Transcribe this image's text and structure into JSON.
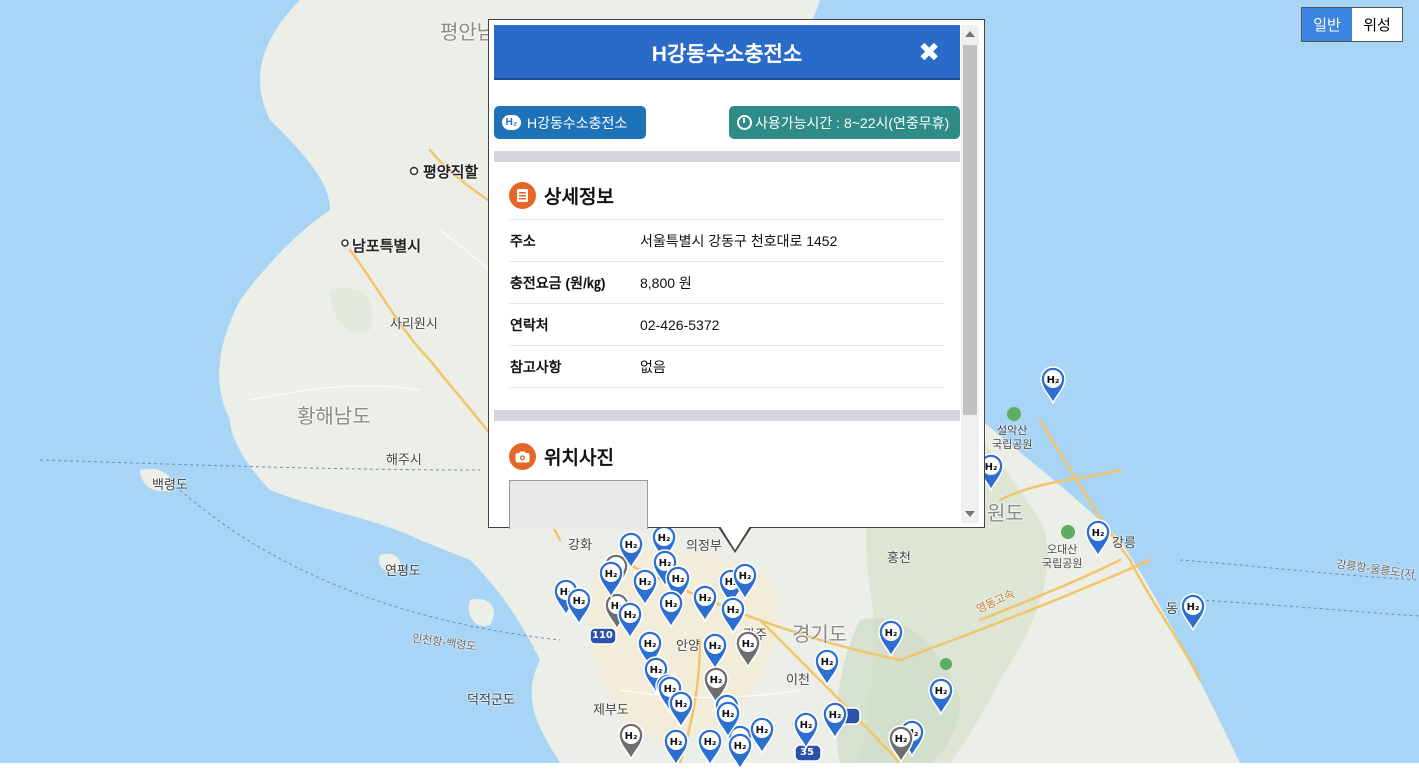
{
  "map_labels": [
    {
      "text": "평안남",
      "cls": "mt-lg"
    },
    {
      "text": "평양직할",
      "cls": "mt-md"
    },
    {
      "text": "남포특별시",
      "cls": "mt-md"
    },
    {
      "text": "사리원시",
      "cls": "mt-sm"
    },
    {
      "text": "황해남도",
      "cls": "mt-lg"
    },
    {
      "text": "해주시",
      "cls": "mt-sm"
    },
    {
      "text": "백령도",
      "cls": "mt-sm"
    },
    {
      "text": "연평도",
      "cls": "mt-sm"
    },
    {
      "text": "인천항-백령도",
      "cls": "mt-road"
    },
    {
      "text": "덕적군도",
      "cls": "mt-sm"
    },
    {
      "text": "제부도",
      "cls": "mt-sm"
    },
    {
      "text": "강화",
      "cls": "mt-sm"
    },
    {
      "text": "의정부",
      "cls": "mt-sm"
    },
    {
      "text": "홍천",
      "cls": "mt-sm"
    },
    {
      "text": "경기도",
      "cls": "mt-lg"
    },
    {
      "text": "광주",
      "cls": "mt-sm"
    },
    {
      "text": "안양",
      "cls": "mt-sm"
    },
    {
      "text": "이천",
      "cls": "mt-sm"
    },
    {
      "text": "원도",
      "cls": "mt-lg"
    },
    {
      "text": "강릉",
      "cls": "mt-sm"
    },
    {
      "text": "동",
      "cls": "mt-sm"
    },
    {
      "text": "설악산\n국립공원",
      "cls": "mt-sm"
    },
    {
      "text": "오대산\n국립공원",
      "cls": "mt-sm"
    },
    {
      "text": "영동고속",
      "cls": "mt-road"
    },
    {
      "text": "강릉항-울릉도(저",
      "cls": "mt-road"
    }
  ],
  "route_shields": [
    "110",
    "35"
  ],
  "pins": [
    {
      "status": "blue"
    },
    {
      "status": "blue"
    },
    {
      "status": "blue"
    },
    {
      "status": "gray"
    },
    {
      "status": "blue"
    },
    {
      "status": "blue"
    },
    {
      "status": "blue"
    },
    {
      "status": "blue"
    },
    {
      "status": "gray"
    },
    {
      "status": "blue"
    },
    {
      "status": "blue"
    },
    {
      "status": "blue"
    },
    {
      "status": "blue"
    },
    {
      "status": "blue"
    },
    {
      "status": "blue"
    },
    {
      "status": "blue"
    },
    {
      "status": "blue"
    },
    {
      "status": "blue"
    },
    {
      "status": "blue"
    },
    {
      "status": "blue"
    },
    {
      "status": "gray"
    },
    {
      "status": "blue"
    },
    {
      "status": "blue"
    },
    {
      "status": "blue"
    },
    {
      "status": "gray"
    },
    {
      "status": "blue"
    },
    {
      "status": "blue"
    },
    {
      "status": "blue"
    },
    {
      "status": "blue"
    },
    {
      "status": "blue"
    },
    {
      "status": "blue"
    },
    {
      "status": "blue"
    },
    {
      "status": "blue"
    },
    {
      "status": "blue"
    },
    {
      "status": "gray"
    },
    {
      "status": "blue"
    },
    {
      "status": "blue"
    },
    {
      "status": "blue"
    },
    {
      "status": "blue"
    },
    {
      "status": "gray"
    },
    {
      "status": "blue"
    },
    {
      "status": "blue"
    },
    {
      "status": "blue"
    }
  ],
  "pin_glyph": "H₂",
  "map_type": {
    "options": [
      "일반",
      "위성"
    ],
    "selected": "일반"
  },
  "popup": {
    "title": "H강동수소충전소",
    "close_icon": "close-icon",
    "station_chip": "H강동수소충전소",
    "hours_chip": "사용가능시간 : 8~22시(연중무휴)",
    "detail_title": "상세정보",
    "details": [
      {
        "key": "주소",
        "value": "서울특별시 강동구 천호대로 1452"
      },
      {
        "key": "충전요금 (원/㎏)",
        "value": "8,800 원"
      },
      {
        "key": "연락처",
        "value": "02-426-5372"
      },
      {
        "key": "참고사항",
        "value": "없음"
      }
    ],
    "photo_title": "위치사진"
  },
  "colors": {
    "water": "#a8d4f5",
    "land": "#eef0ea",
    "header": "#2a6bc9",
    "pin_blue": "#2c6fd1",
    "pin_gray": "#6e6e6e"
  }
}
